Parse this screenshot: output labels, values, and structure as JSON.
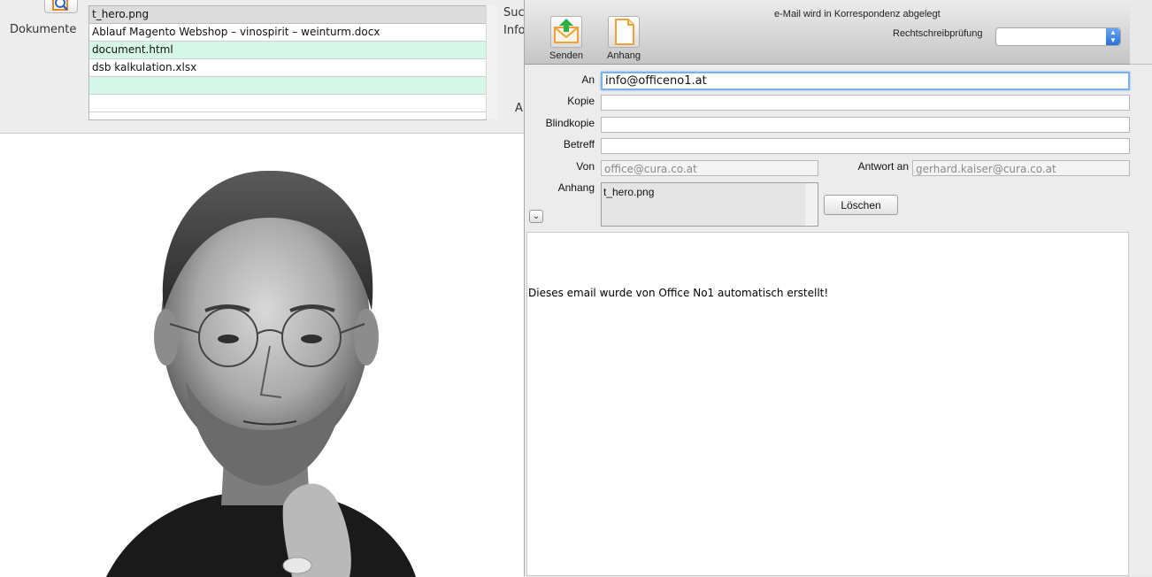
{
  "left_window": {
    "documents_label": "Dokumente",
    "documents": [
      {
        "name": "t_hero.png"
      },
      {
        "name": "Ablauf Magento Webshop – vinospirit – weinturm.docx"
      },
      {
        "name": "document.html"
      },
      {
        "name": "dsb kalkulation.xlsx"
      },
      {
        "name": ""
      },
      {
        "name": ""
      }
    ],
    "side_text_1": "Suc",
    "side_text_2": "Info",
    "side_text_3": "A"
  },
  "mail": {
    "status_text": "e-Mail wird in Korrespondenz abgelegt",
    "toolbar": {
      "send_label": "Senden",
      "attach_label": "Anhang"
    },
    "spellcheck_label": "Rechtschreibprüfung",
    "spellcheck_value": "",
    "fields": {
      "to_label": "An",
      "to_value": "info@officeno1.at",
      "cc_label": "Kopie",
      "cc_value": "",
      "bcc_label": "Blindkopie",
      "bcc_value": "",
      "subject_label": "Betreff",
      "subject_value": "",
      "from_label": "Von",
      "from_value": "office@cura.co.at",
      "replyto_label": "Antwort an",
      "replyto_value": "gerhard.kaiser@cura.co.at",
      "attachment_label": "Anhang",
      "attachment_value": "t_hero.png"
    },
    "delete_label": "Löschen",
    "body_text": "Dieses email wurde von Office No1 automatisch erstellt!",
    "colors": {
      "accent_green": "#2bb34a",
      "icon_orange": "#f0a23a",
      "focus_blue": "#7ab1ee",
      "list_alt_row": "#d6f7e8"
    }
  }
}
